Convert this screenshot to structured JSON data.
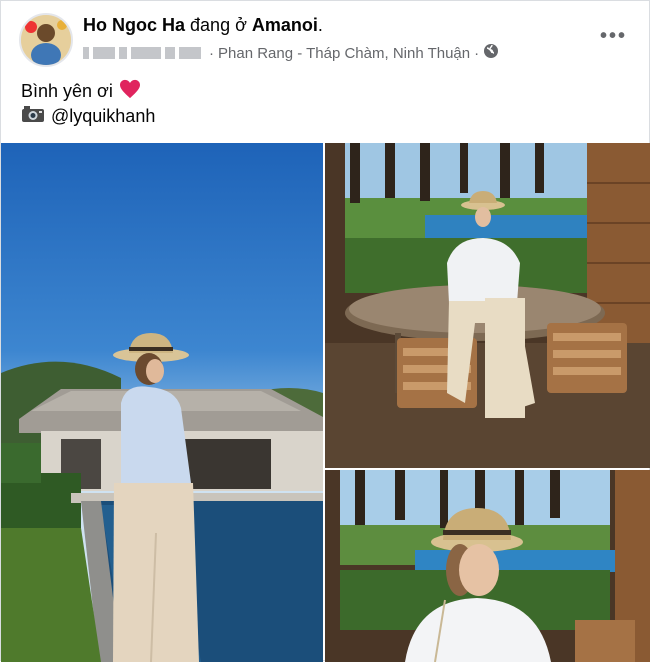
{
  "post": {
    "author": "Ho Ngoc Ha",
    "activity": "đang ở",
    "location": "Amanoi",
    "place_line": "Phan Rang - Tháp Chàm, Ninh Thuận",
    "separator": "·",
    "audience_icon": "globe-icon",
    "more_label": "•••",
    "caption_line1": "Bình yên ơi",
    "caption_emoji": "heart-emoji",
    "caption_line2": "@lyquikhanh",
    "camera_icon": "camera-icon"
  },
  "colors": {
    "text": "#050505",
    "secondary": "#65676b",
    "heart": "#e0245e",
    "sky": "#2f7cc9",
    "pool": "#1b4e7a",
    "lawn": "#4f7a2c"
  },
  "photos": [
    {
      "name": "photo-pool-villa",
      "description_icon": "image"
    },
    {
      "name": "photo-terrace-seated",
      "description_icon": "image"
    },
    {
      "name": "photo-terrace-closeup",
      "description_icon": "image"
    }
  ]
}
